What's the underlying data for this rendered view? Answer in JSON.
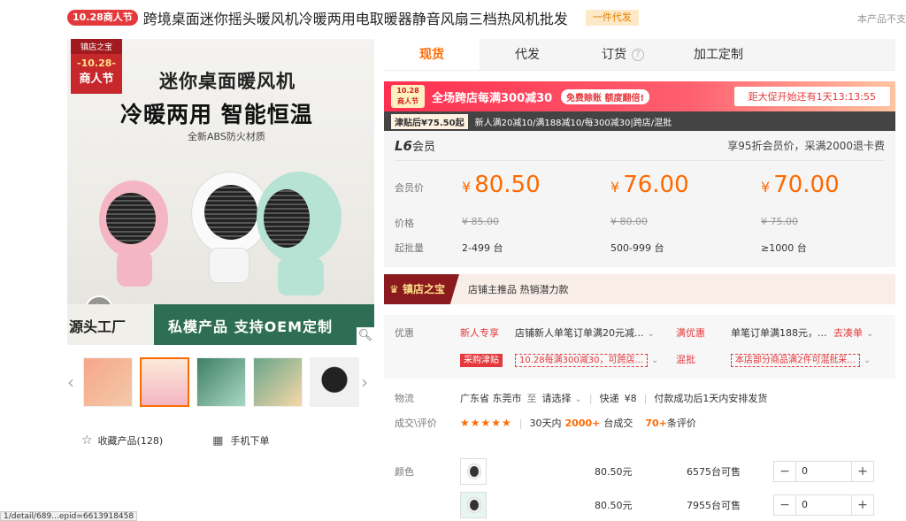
{
  "header": {
    "festival_badge": "10.28商人节",
    "product_title": "跨境桌面迷你摇头暖风机冷暖两用电取暖器静音风扇三档热风机批发",
    "dropship_tag": "一件代发",
    "not_supported_note": "本产品不支"
  },
  "gallery": {
    "store_badge_top": "镇店之宝",
    "store_badge_line1": "-10.28-",
    "store_badge_line2": "商人节",
    "headline1": "迷你桌面暖风机",
    "headline2": "冷暖两用 智能恒温",
    "headline3": "全新ABS防火材质",
    "banner_left": "源头工厂",
    "banner_right": "私模产品 支持OEM定制",
    "zoom_icon": "search-icon",
    "thumb_count": 5
  },
  "actions": {
    "favorite_label": "收藏产品(128)",
    "mobile_order_label": "手机下单"
  },
  "tabs": [
    {
      "label": "现货",
      "active": true
    },
    {
      "label": "代发",
      "active": false
    },
    {
      "label": "订货",
      "active": false
    },
    {
      "label": "加工定制",
      "active": false
    }
  ],
  "promo": {
    "badge_line1": "10.28",
    "badge_line2": "商人节",
    "text": "全场跨店每满300减30",
    "tag": "免费赊账 额度翻倍!",
    "countdown": "距大促开始还有1天13:13:55"
  },
  "subsidy": {
    "price": "津贴后¥75.50起",
    "rules": "新人满20减10/满188减10/每300减30|跨店/混批"
  },
  "member": {
    "level": "L6",
    "level_suffix": "会员",
    "perk": "享95折会员价，采满2000退卡费"
  },
  "pricing": {
    "labels": {
      "member_price": "会员价",
      "price": "价格",
      "min_batch": "起批量"
    },
    "currency": "¥",
    "tiers": [
      {
        "member_price": "80.50",
        "price": "¥ 85.00",
        "qty": "2-499 台"
      },
      {
        "member_price": "76.00",
        "price": "¥ 80.00",
        "qty": "500-999 台"
      },
      {
        "member_price": "70.00",
        "price": "¥ 75.00",
        "qty": "≥1000 台"
      }
    ]
  },
  "treasure": {
    "logo": "镇店之宝",
    "text": "店铺主推品 热销潜力款"
  },
  "offers": {
    "label": "优惠",
    "new_user_label": "新人专享",
    "new_user_text": "店铺新人单笔订单满20元减...",
    "full_discount_label": "满优惠",
    "full_discount_text": "单笔订单满188元，...",
    "go_link": "去凑单",
    "subsidy_tag": "采购津贴",
    "subsidy_ticket": "10.28每满300减30，可跨店...",
    "mixed_label": "混批",
    "mixed_ticket": "本店部分商品满2件可混批采..."
  },
  "logistics": {
    "label": "物流",
    "origin": "广东省 东莞市",
    "to": "至",
    "dest": "请选择",
    "express_label": "快递",
    "express_fee": "¥8",
    "ship_note": "付款成功后1天内安排发货"
  },
  "deals": {
    "label": "成交\\评价",
    "stars": "★★★★★",
    "prefix": "30天内",
    "count": "2000+",
    "unit": "台成交",
    "reviews": "70+",
    "reviews_unit": "条评价"
  },
  "sku": {
    "label": "颜色",
    "rows": [
      {
        "price": "80.50元",
        "stock": "6575台可售",
        "qty": "0"
      },
      {
        "price": "80.50元",
        "stock": "7955台可售",
        "qty": "0"
      }
    ]
  },
  "status_bar": {
    "url": "1/detail/689...epid=6613918458"
  }
}
